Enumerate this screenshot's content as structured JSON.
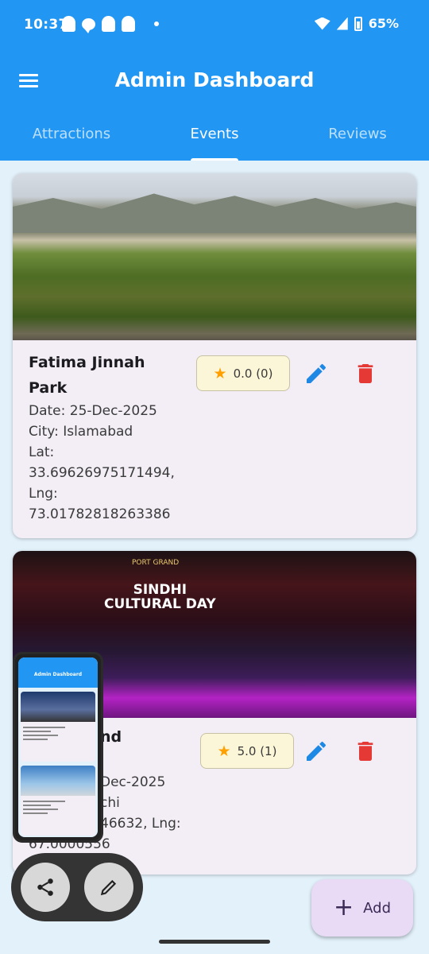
{
  "status_bar": {
    "time": "10:37",
    "battery": "65%"
  },
  "app_bar": {
    "title": "Admin Dashboard"
  },
  "tabs": [
    {
      "label": "Attractions",
      "active": false
    },
    {
      "label": "Events",
      "active": true
    },
    {
      "label": "Reviews",
      "active": false
    }
  ],
  "cards": [
    {
      "name": "Fatima Jinnah Park",
      "date": "Date: 25-Dec-2025",
      "city": "City: Islamabad",
      "lat": "Lat:",
      "lat_value": "33.69626975171494,",
      "lng": "Lng:",
      "lng_value": "73.01782818263386",
      "rating": "0.0 (0)"
    },
    {
      "name_partial": "nd",
      "date_partial": "Dec-2025",
      "city_partial": "chi",
      "coords_partial": "46632, Lng:",
      "coords_partial2": "67.0000556",
      "rating": "5.0 (1)"
    }
  ],
  "photo_text": {
    "brand": "PORT GRAND",
    "line1": "SINDHI",
    "line2": "CULTURAL DAY"
  },
  "pip": {
    "title": "Admin Dashboard"
  },
  "fab": {
    "label": "Add"
  },
  "colors": {
    "primary": "#2196f3",
    "accent_star": "#ffa000",
    "delete": "#e53935",
    "edit": "#1e88e5",
    "fab_bg": "#e9dbf5"
  }
}
